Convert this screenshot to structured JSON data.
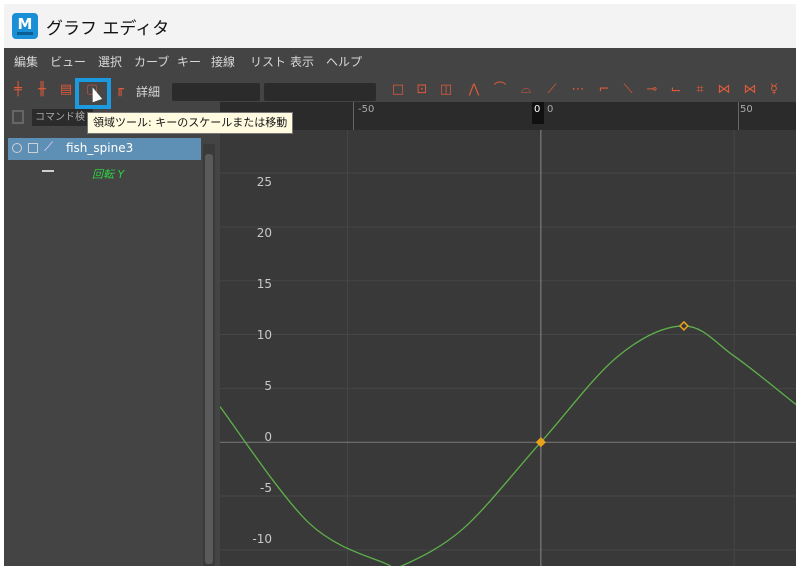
{
  "window": {
    "title": "グラフ エディタ",
    "app_icon_letter": "M"
  },
  "menu": [
    "編集",
    "ビュー",
    "選択",
    "カーブ",
    "キー",
    "接線",
    "リスト",
    "表示",
    "ヘルプ"
  ],
  "toolbar": {
    "details_label": "詳細",
    "tooltip": "領域ツール: キーのスケールまたは移動",
    "highlighted_tool": "region-tool"
  },
  "search": {
    "placeholder": "コマンド検"
  },
  "outliner": {
    "object": "fish_spine3",
    "attribute": "回転 Y"
  },
  "timeline": {
    "labels": [
      "-50",
      "0",
      "50"
    ],
    "current_frame": "0"
  },
  "graph": {
    "y_ticks": [
      "25",
      "20",
      "15",
      "10",
      "5",
      "0",
      "-5",
      "-10"
    ],
    "curve_color": "#5eb04a",
    "key_color": "#e8a21a"
  },
  "chart_data": {
    "type": "line",
    "x_range": [
      -83,
      66
    ],
    "y_range": [
      -11.5,
      29
    ],
    "keys": [
      {
        "x": 0,
        "y": 0
      },
      {
        "x": 37,
        "y": 10.8
      }
    ],
    "series": [
      {
        "x": [
          -83,
          -60,
          -40,
          -36,
          -20,
          0,
          20,
          37,
          50,
          66
        ],
        "y": [
          3.3,
          -7.5,
          -11.3,
          -11.5,
          -8,
          0,
          8,
          10.8,
          8,
          3.5
        ]
      }
    ]
  }
}
